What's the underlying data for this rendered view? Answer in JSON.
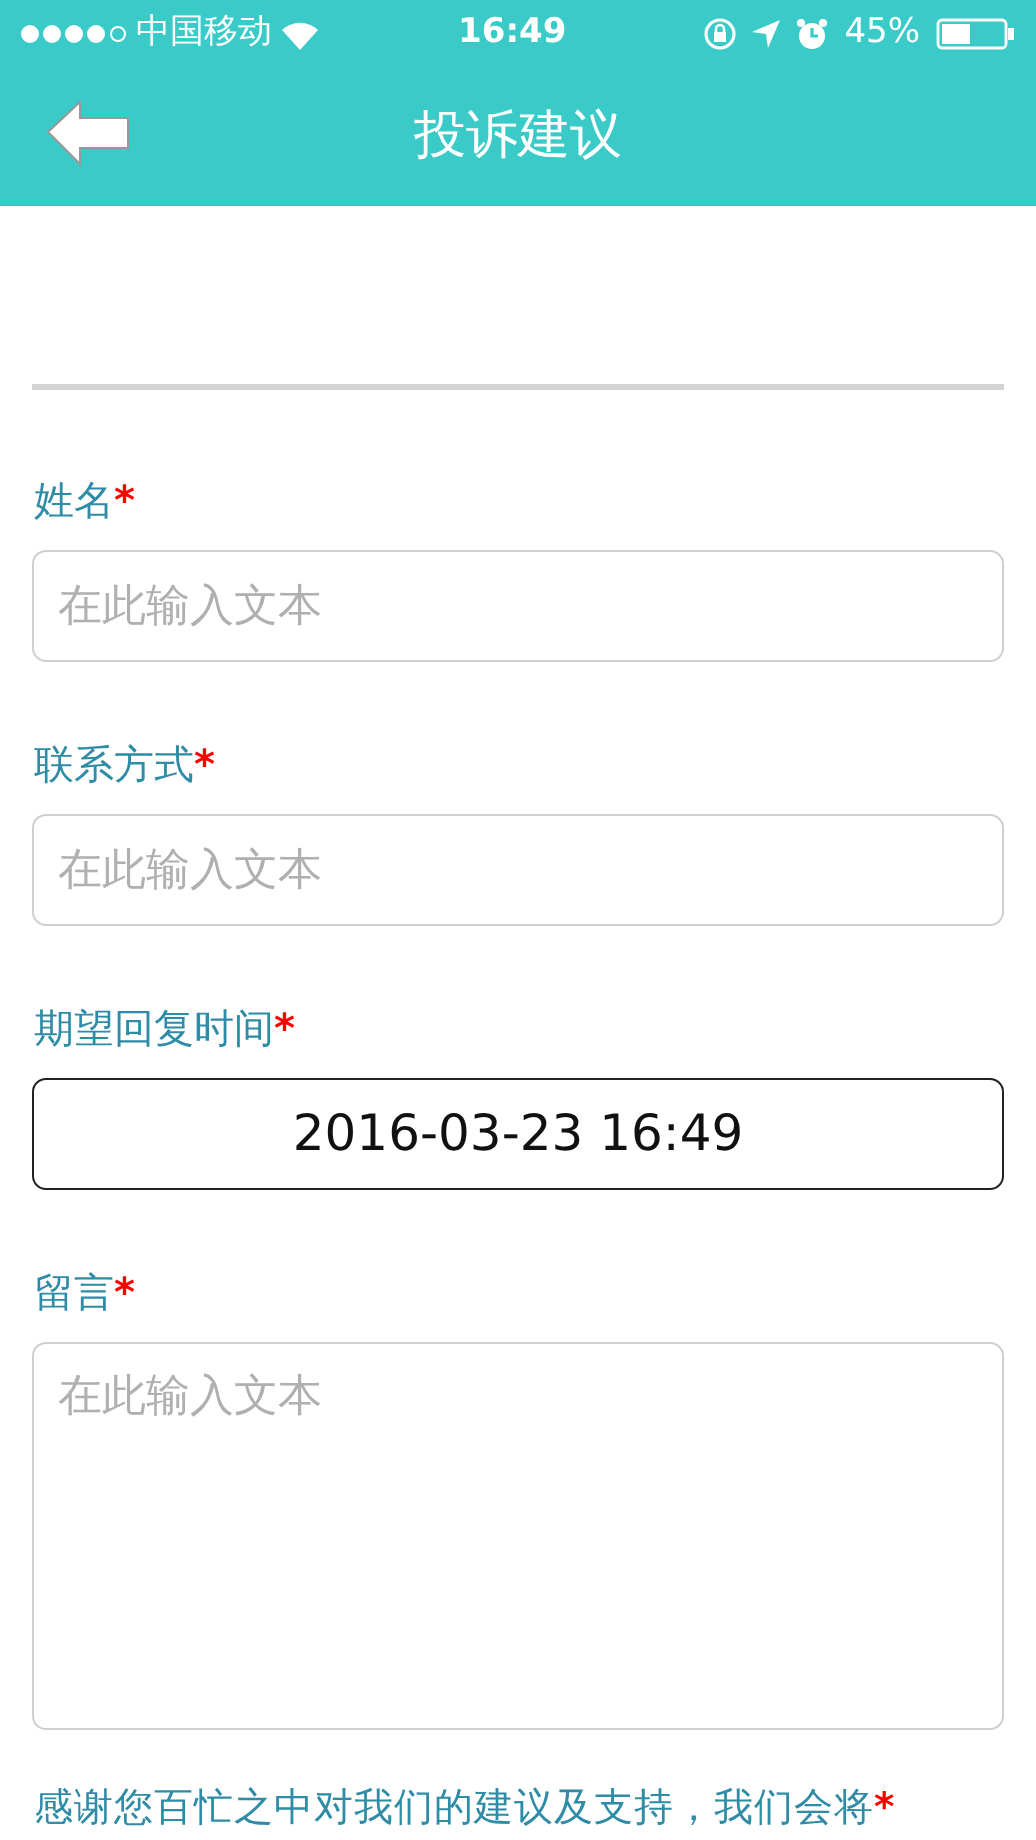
{
  "status_bar": {
    "carrier": "中国移动",
    "time": "16:49",
    "battery": "45%"
  },
  "nav_bar": {
    "title": "投诉建议"
  },
  "fields": [
    {
      "kind": "input",
      "label": "姓名",
      "required_mark": "*",
      "placeholder": "在此输入文本"
    },
    {
      "kind": "input",
      "label": "联系方式",
      "required_mark": "*",
      "placeholder": "在此输入文本"
    },
    {
      "kind": "datetime",
      "label": "期望回复时间",
      "required_mark": "*",
      "value": "2016-03-23 16:49"
    },
    {
      "kind": "textarea",
      "label": "留言",
      "required_mark": "*",
      "placeholder": "在此输入文本"
    }
  ],
  "footer_note": {
    "text": "感谢您百忙之中对我们的建议及支持，我们会将",
    "required_mark": "*"
  }
}
